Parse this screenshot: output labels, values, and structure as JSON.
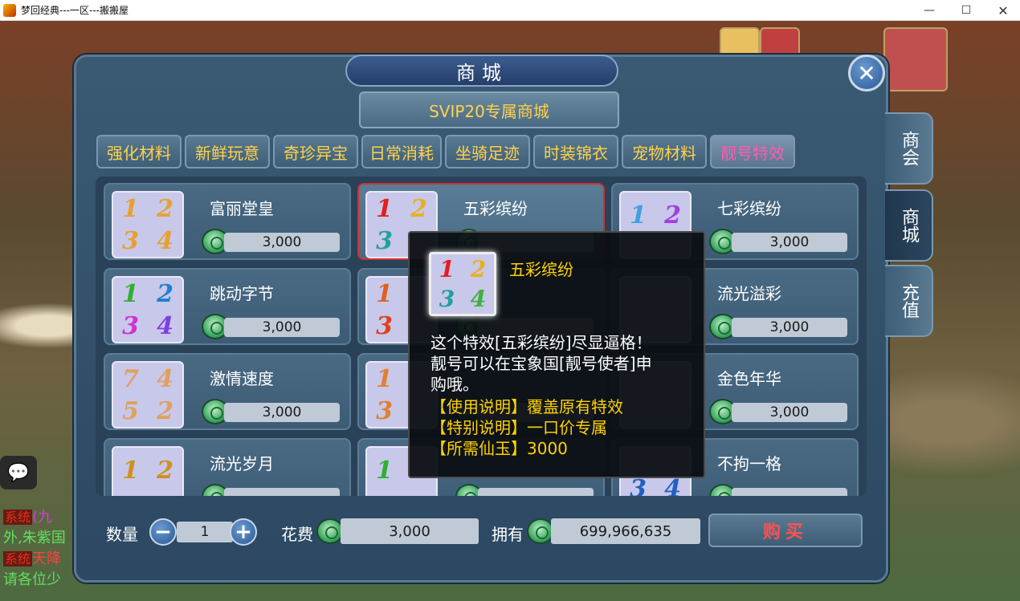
{
  "window": {
    "title": "梦回经典---一区---搬搬屋",
    "min": "—",
    "max": "☐",
    "close": "✕"
  },
  "shop": {
    "title": "商城",
    "close_glyph": "✕",
    "svip_label": "SVIP20专属商城",
    "tabs": [
      "强化材料",
      "新鲜玩意",
      "奇珍异宝",
      "日常消耗",
      "坐骑足迹",
      "时装锦衣",
      "宠物材料",
      "靓号特效"
    ],
    "active_tab": "靓号特效",
    "side_tabs": [
      "商会",
      "商城",
      "充值"
    ],
    "active_side_tab": "商城",
    "items": [
      {
        "name": "富丽堂皇",
        "price": "3,000",
        "digits": [
          "1",
          "2",
          "3",
          "4"
        ],
        "colors": [
          "#e8a030",
          "#e8a030",
          "#e8a030",
          "#e8a030"
        ]
      },
      {
        "name": "五彩缤纷",
        "price": "",
        "digits": [
          "1",
          "2",
          "3",
          ""
        ],
        "colors": [
          "#e02020",
          "#e8b020",
          "#20a0a0",
          "#40b040"
        ]
      },
      {
        "name": "七彩缤纷",
        "price": "3,000",
        "digits": [
          "1",
          "2",
          "",
          ""
        ],
        "colors": [
          "#40a0e0",
          "#a040e0",
          "",
          ""
        ]
      },
      {
        "name": "跳动字节",
        "price": "3,000",
        "digits": [
          "1",
          "2",
          "3",
          "4"
        ],
        "colors": [
          "#30b030",
          "#2080d0",
          "#d030d0",
          "#8040e0"
        ]
      },
      {
        "name": "",
        "price": "",
        "digits": [
          "1",
          "",
          "3",
          ""
        ],
        "colors": [
          "#e06020",
          "",
          "#e04020",
          ""
        ]
      },
      {
        "name": "流光溢彩",
        "price": "3,000",
        "digits": [
          "",
          "",
          "",
          ""
        ],
        "colors": [
          "",
          "",
          "",
          ""
        ]
      },
      {
        "name": "激情速度",
        "price": "3,000",
        "digits": [
          "7",
          "4",
          "5",
          "2"
        ],
        "colors": [
          "#e0a060",
          "#e0a060",
          "#e0a060",
          "#e0a060"
        ]
      },
      {
        "name": "",
        "price": "",
        "digits": [
          "1",
          "",
          "3",
          ""
        ],
        "colors": [
          "#e08030",
          "",
          "#e08030",
          ""
        ]
      },
      {
        "name": "金色年华",
        "price": "3,000",
        "digits": [
          "",
          "",
          "",
          ""
        ],
        "colors": [
          "",
          "",
          "",
          ""
        ]
      },
      {
        "name": "流光岁月",
        "price": "",
        "digits": [
          "1",
          "2",
          "",
          ""
        ],
        "colors": [
          "#d09020",
          "#d09020",
          "",
          ""
        ]
      },
      {
        "name": "",
        "price": "",
        "digits": [
          "1",
          "",
          "",
          ""
        ],
        "colors": [
          "#30b030",
          "",
          "",
          ""
        ]
      },
      {
        "name": "不拘一格",
        "price": "",
        "digits": [
          "",
          "",
          "3",
          "4"
        ],
        "colors": [
          "",
          "",
          "#2060c0",
          "#2060c0"
        ]
      }
    ]
  },
  "tooltip": {
    "name": "五彩缤纷",
    "digits": [
      "1",
      "2",
      "3",
      "4"
    ],
    "colors": [
      "#e02020",
      "#e8b020",
      "#20a0a0",
      "#40b040"
    ],
    "line1": "这个特效[五彩缤纷]尽显逼格！",
    "line2": "靓号可以在宝象国[靓号使者]申",
    "line3": "购哦。",
    "usage": "【使用说明】覆盖原有特效",
    "special": "【特别说明】一口价专属",
    "cost": "【所需仙玉】3000"
  },
  "bottom": {
    "qty_label": "数量",
    "minus": "−",
    "qty_value": "1",
    "plus": "+",
    "cost_label": "花费",
    "cost_value": "3,000",
    "owned_label": "拥有",
    "owned_value": "699,966,635",
    "buy_label": "购买"
  },
  "chat": {
    "icon": "💬",
    "lines": [
      {
        "sys": "系统",
        "text": "(九"
      },
      {
        "sys": "",
        "text": "外,朱紫国"
      },
      {
        "sys": "系统",
        "text": "天降"
      },
      {
        "sys": "",
        "text": "请各位少"
      }
    ]
  }
}
